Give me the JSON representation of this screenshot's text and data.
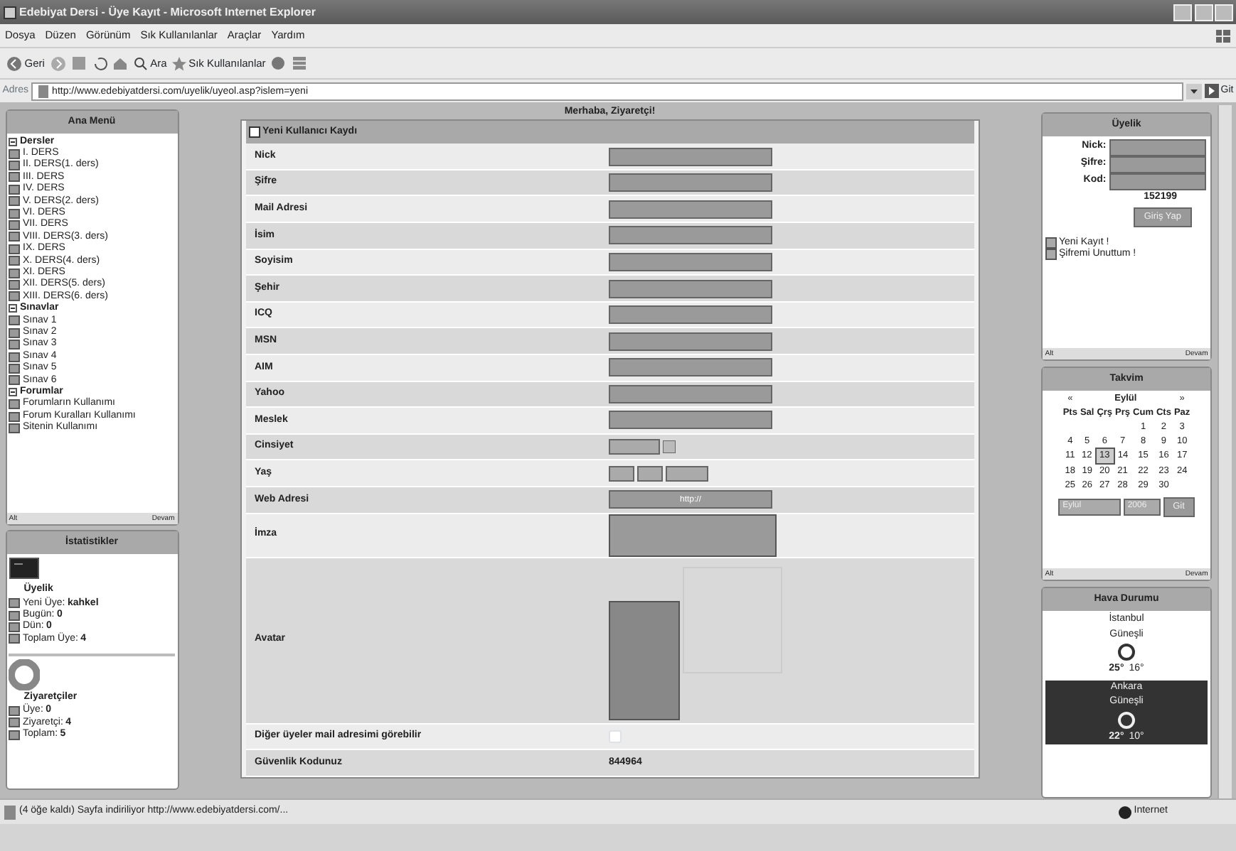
{
  "window": {
    "title": "Edebiyat Dersi - Üye Kayıt - Microsoft Internet Explorer"
  },
  "menu": [
    "Dosya",
    "Düzen",
    "Görünüm",
    "Sık Kullanılanlar",
    "Araçlar",
    "Yardım"
  ],
  "toolbar": {
    "back": "Geri",
    "search": "Ara",
    "favorites": "Sık Kullanılanlar"
  },
  "address": {
    "label": "Adres",
    "url": "http://www.edebiyatdersi.com/uyelik/uyeol.asp?islem=yeni",
    "go": "Git"
  },
  "main_menu": {
    "title": "Ana Menü",
    "groups": [
      {
        "label": "Dersler",
        "children": [
          "I. DERS",
          "II. DERS(1. ders)",
          "III. DERS",
          "IV. DERS",
          "V. DERS(2. ders)",
          "VI. DERS",
          "VII. DERS",
          "VIII. DERS(3. ders)",
          "IX. DERS",
          "X. DERS(4. ders)",
          "XI. DERS",
          "XII. DERS(5. ders)",
          "XIII. DERS(6. ders)"
        ]
      },
      {
        "label": "Sınavlar",
        "children": [
          "Sınav 1",
          "Sınav 2",
          "Sınav 3",
          "Sınav 4",
          "Sınav 5",
          "Sınav 6"
        ]
      },
      {
        "label": "Forumlar",
        "children": [
          "Forumların Kullanımı",
          "Forum Kuralları Kullanımı",
          "Sitenin Kullanımı"
        ]
      }
    ],
    "footer_left": "Alt",
    "footer_right": "Devam"
  },
  "stats": {
    "title": "İstatistikler",
    "sections": [
      {
        "kind": "members",
        "heading": "Üyelik",
        "lines": [
          {
            "label": "Yeni Üye:",
            "value": "kahkel"
          },
          {
            "label": "Bugün:",
            "value": "0"
          },
          {
            "label": "Dün:",
            "value": "0"
          },
          {
            "label": "Toplam Üye:",
            "value": "4"
          }
        ]
      },
      {
        "kind": "visitors",
        "heading": "Ziyaretçiler",
        "lines": [
          {
            "label": "Üye:",
            "value": "0"
          },
          {
            "label": "Ziyaretçi:",
            "value": "4"
          },
          {
            "label": "Toplam:",
            "value": "5"
          }
        ]
      }
    ]
  },
  "greeting": "Merhaba, Ziyaretçi!",
  "form": {
    "title": "Yeni Kullanıcı Kaydı",
    "rows": [
      {
        "label": "Nick",
        "kind": "text"
      },
      {
        "label": "Şifre",
        "kind": "text"
      },
      {
        "label": "Mail Adresi",
        "kind": "text"
      },
      {
        "label": "İsim",
        "kind": "text"
      },
      {
        "label": "Soyisim",
        "kind": "text"
      },
      {
        "label": "Şehir",
        "kind": "text"
      },
      {
        "label": "ICQ",
        "kind": "text"
      },
      {
        "label": "MSN",
        "kind": "text"
      },
      {
        "label": "AIM",
        "kind": "text"
      },
      {
        "label": "Yahoo",
        "kind": "text"
      },
      {
        "label": "Meslek",
        "kind": "text"
      },
      {
        "label": "Cinsiyet",
        "kind": "select"
      },
      {
        "label": "Yaş",
        "kind": "date"
      },
      {
        "label": "Web Adresi",
        "kind": "text",
        "value": "http://"
      },
      {
        "label": "İmza",
        "kind": "textarea"
      },
      {
        "label": "Avatar",
        "kind": "avatar"
      },
      {
        "label": "Diğer üyeler mail adresimi görebilir",
        "kind": "checkbox",
        "checked": false
      },
      {
        "label": "Güvenlik Kodunuz",
        "kind": "static",
        "value": "844964"
      }
    ]
  },
  "login": {
    "title": "Üyelik",
    "fields": [
      "Nick:",
      "Şifre:",
      "Kod:"
    ],
    "code": "152199",
    "button": "Giriş Yap",
    "links": [
      "Yeni Kayıt !",
      "Şifremi Unuttum !"
    ],
    "footer_left": "Alt",
    "footer_right": "Devam"
  },
  "calendar": {
    "title": "Takvim",
    "month": "Eylül",
    "prev": "«",
    "next": "»",
    "weekdays": [
      "Pts",
      "Sal",
      "Çrş",
      "Prş",
      "Cum",
      "Cts",
      "Paz"
    ],
    "weeks": [
      {
        "kind": "end",
        "days": [
          {
            "day": "1",
            "selected": false
          },
          {
            "day": "2",
            "selected": false
          },
          {
            "day": "3",
            "selected": false
          }
        ]
      },
      {
        "kind": "full",
        "days": [
          {
            "day": "4",
            "selected": false
          },
          {
            "day": "5",
            "selected": false
          },
          {
            "day": "6",
            "selected": false
          },
          {
            "day": "7",
            "selected": false
          },
          {
            "day": "8",
            "selected": false
          },
          {
            "day": "9",
            "selected": false
          },
          {
            "day": "10",
            "selected": false
          }
        ]
      },
      {
        "kind": "full",
        "days": [
          {
            "day": "11",
            "selected": false
          },
          {
            "day": "12",
            "selected": false
          },
          {
            "day": "13",
            "selected": true
          },
          {
            "day": "14",
            "selected": false
          },
          {
            "day": "15",
            "selected": false
          },
          {
            "day": "16",
            "selected": false
          },
          {
            "day": "17",
            "selected": false
          }
        ]
      },
      {
        "kind": "full",
        "days": [
          {
            "day": "18",
            "selected": false
          },
          {
            "day": "19",
            "selected": false
          },
          {
            "day": "20",
            "selected": false
          },
          {
            "day": "21",
            "selected": false
          },
          {
            "day": "22",
            "selected": false
          },
          {
            "day": "23",
            "selected": false
          },
          {
            "day": "24",
            "selected": false
          }
        ]
      },
      {
        "kind": "start",
        "days": [
          {
            "day": "25",
            "selected": false
          },
          {
            "day": "26",
            "selected": false
          },
          {
            "day": "27",
            "selected": false
          },
          {
            "day": "28",
            "selected": false
          },
          {
            "day": "29",
            "selected": false
          },
          {
            "day": "30",
            "selected": false
          }
        ]
      }
    ],
    "month_select": "Eylül",
    "year_select": "2006",
    "go": "Git",
    "footer_left": "Alt",
    "footer_right": "Devam"
  },
  "weather": {
    "title": "Hava Durumu",
    "cities": [
      {
        "name": "İstanbul",
        "sky": "Güneşli",
        "temp": "25°",
        "low": "16°"
      },
      {
        "name": "Ankara",
        "sky": "Güneşli",
        "temp": "22°",
        "low": "10°"
      }
    ]
  },
  "status_bar": {
    "text": "(4 öğe kaldı) Sayfa indiriliyor http://www.edebiyatdersi.com/...",
    "zone": "Internet"
  }
}
